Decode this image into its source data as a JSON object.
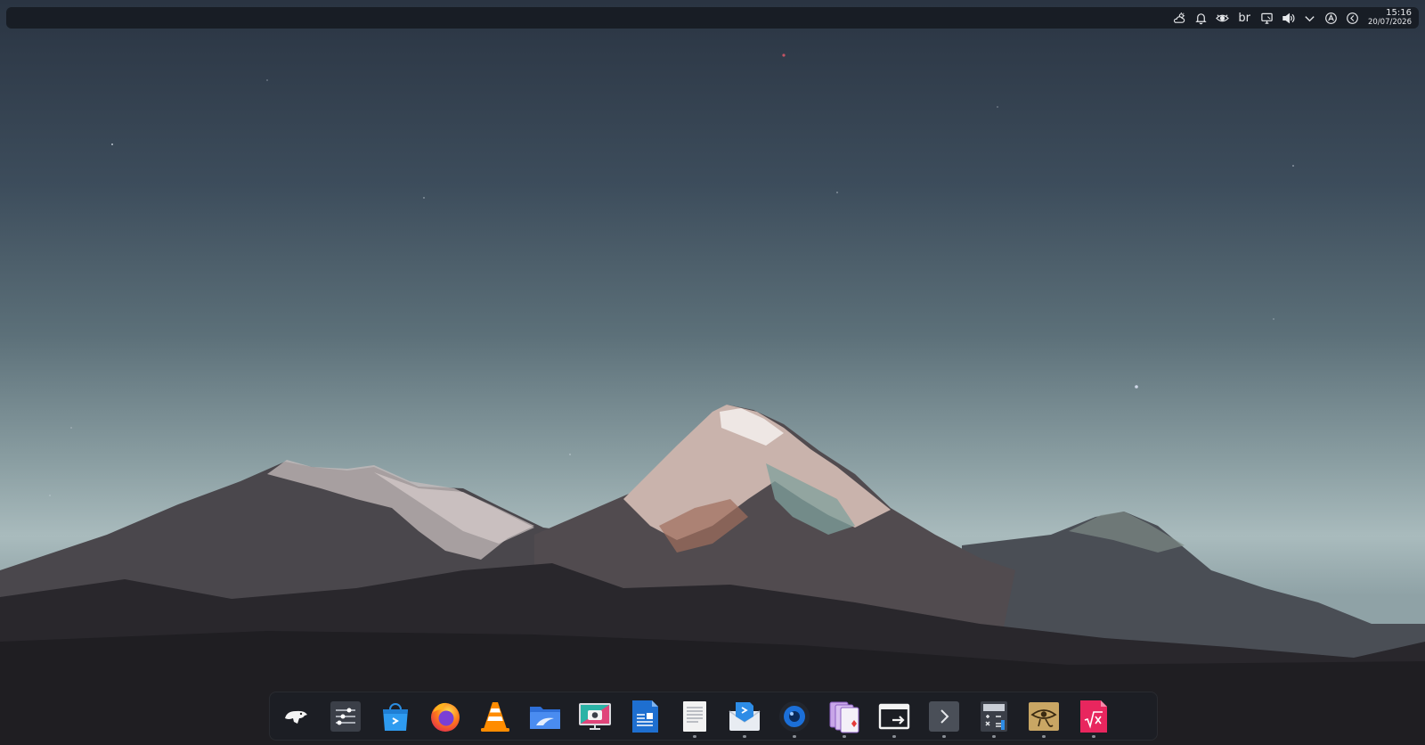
{
  "topbar": {
    "tray": {
      "weather_icon": "weather-cloud-sun-icon",
      "notifications_icon": "bell-icon",
      "eye_icon": "eye-icon",
      "keyboard_layout": "br",
      "display_icon": "display-icon",
      "volume_icon": "volume-icon",
      "expand_icon": "chevron-down-icon",
      "vpn_icon": "vpn-icon",
      "back_icon": "circle-back-icon"
    },
    "clock": {
      "time": "15:16",
      "date": "20/07/2026"
    }
  },
  "dock": {
    "items": [
      {
        "icon": "app-menu-icon",
        "running": false
      },
      {
        "icon": "settings-sliders-icon",
        "running": false
      },
      {
        "icon": "software-store-icon",
        "running": false
      },
      {
        "icon": "firefox-icon",
        "running": false
      },
      {
        "icon": "vlc-icon",
        "running": false
      },
      {
        "icon": "file-manager-icon",
        "running": false
      },
      {
        "icon": "screenshot-icon",
        "running": false
      },
      {
        "icon": "writer-icon",
        "running": false
      },
      {
        "icon": "text-editor-icon",
        "running": true
      },
      {
        "icon": "mail-icon",
        "running": true
      },
      {
        "icon": "camera-icon",
        "running": true
      },
      {
        "icon": "cards-icon",
        "running": true
      },
      {
        "icon": "remote-desktop-icon",
        "running": true
      },
      {
        "icon": "terminal-icon",
        "running": true
      },
      {
        "icon": "calculator-icon",
        "running": true
      },
      {
        "icon": "papyrus-eye-icon",
        "running": true
      },
      {
        "icon": "math-formula-icon",
        "running": true
      }
    ]
  },
  "colors": {
    "accent_red": "#e8265e",
    "panel_bg": "#161a21"
  }
}
